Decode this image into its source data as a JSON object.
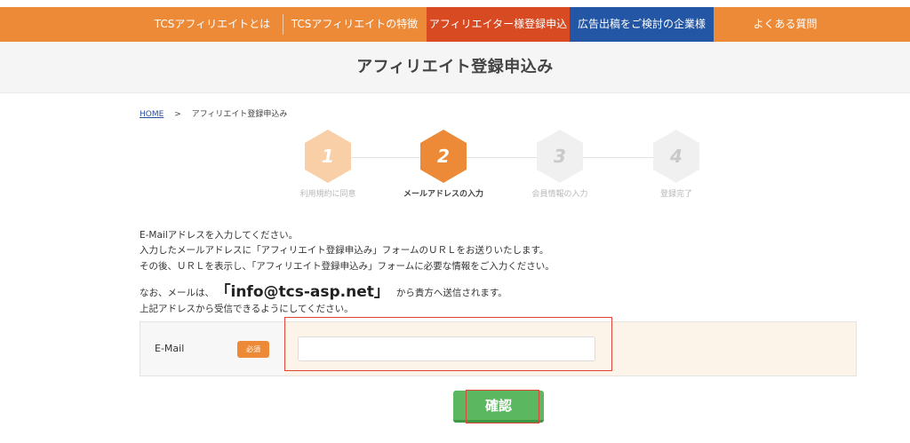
{
  "nav": {
    "items": [
      {
        "label": "TCSアフィリエイトとは"
      },
      {
        "label": "TCSアフィリエイトの特徴"
      },
      {
        "label": "アフィリエイター様登録申込"
      },
      {
        "label": "広告出稿をご検討の企業様"
      },
      {
        "label": "よくある質問"
      }
    ],
    "colors": {
      "base": "#ec8a38",
      "active": "#d84a21",
      "advertiser": "#2356a5"
    }
  },
  "page": {
    "title": "アフィリエイト登録申込み"
  },
  "breadcrumb": {
    "home": "HOME",
    "separator": ">",
    "current": "アフィリエイト登録申込み"
  },
  "steps": [
    {
      "number": "1",
      "label": "利用規約に同意",
      "state": "done"
    },
    {
      "number": "2",
      "label": "メールアドレスの入力",
      "state": "current"
    },
    {
      "number": "3",
      "label": "会員情報の入力",
      "state": "todo"
    },
    {
      "number": "4",
      "label": "登録完了",
      "state": "todo"
    }
  ],
  "instructions": {
    "line1": "E-Mailアドレスを入力してください。",
    "line2": "入力したメールアドレスに「アフィリエイト登録申込み」フォームのＵＲＬをお送りいたします。",
    "line3": "その後、ＵＲＬを表示し、「アフィリエイト登録申込み」フォームに必要な情報をご入力ください。",
    "line4_prefix": "なお、メールは、",
    "line4_email": "「info@tcs-asp.net」",
    "line4_suffix": "から貴方へ送信されます。",
    "line5": "上記アドレスから受信できるようにしてください。"
  },
  "form": {
    "email_label": "E-Mail",
    "required_badge": "必須",
    "email_value": "",
    "email_placeholder": ""
  },
  "submit": {
    "label": "確認"
  }
}
